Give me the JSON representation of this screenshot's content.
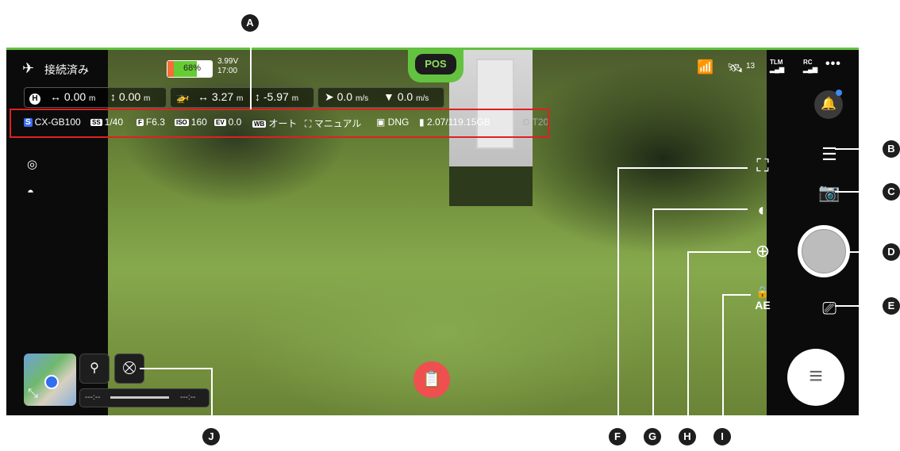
{
  "status": {
    "connection": "接続済み",
    "battery_percent": "68%",
    "battery_voltage": "3.99V",
    "battery_time": "17:00",
    "flight_mode": "POS",
    "satellite_count": "13",
    "tlm_label": "TLM",
    "rc_label": "RC",
    "more": "•••"
  },
  "telemetry": {
    "home_icon": "H",
    "home_horizontal": "↔ 0.00",
    "home_vertical": "↕ 0.00",
    "drone_horizontal": "↔ 3.27",
    "drone_vertical": "↕ -5.97",
    "unit_m": "m",
    "horizontal_speed": "➤ 0.0",
    "vertical_speed": "▼ 0.0",
    "unit_ms": "m/s"
  },
  "camera_params": {
    "storage_tag": "S",
    "camera_model": "CX-GB100",
    "ss_tag": "SS",
    "shutter_speed": "1/40",
    "f_tag": "F",
    "aperture": "F6.3",
    "iso_tag": "ISO",
    "iso": "160",
    "ev_tag": "EV",
    "ev": "0.0",
    "wb_tag": "WB",
    "white_balance": "オート",
    "focus_mode": "マニュアル",
    "format": "DNG",
    "storage": "2.07/119.15GB",
    "timer": "T20"
  },
  "timeline": {
    "start": "---:--",
    "end": "---:--"
  },
  "callouts": [
    "A",
    "B",
    "C",
    "D",
    "E",
    "F",
    "G",
    "H",
    "I",
    "J"
  ],
  "colors": {
    "accent_green": "#63c23f",
    "record_red": "#ef4f4f",
    "highlight_red": "#e02020",
    "notification_blue": "#3b8cf5"
  },
  "icons": {
    "drone": "drone-icon",
    "wifi": "wifi-icon",
    "satellite": "satellite-icon",
    "bell": "bell-icon",
    "settings": "sliders-icon",
    "camera_switch": "camera-icon",
    "cast": "cast-icon",
    "menu": "menu-icon",
    "focus": "focus-icon",
    "gimbal": "gimbal-icon",
    "zoom": "zoom-in-icon",
    "ae_lock": "ae-lock-icon",
    "location": "location-pin-icon",
    "obstacle": "obstacle-off-icon",
    "checklist": "checklist-icon"
  }
}
